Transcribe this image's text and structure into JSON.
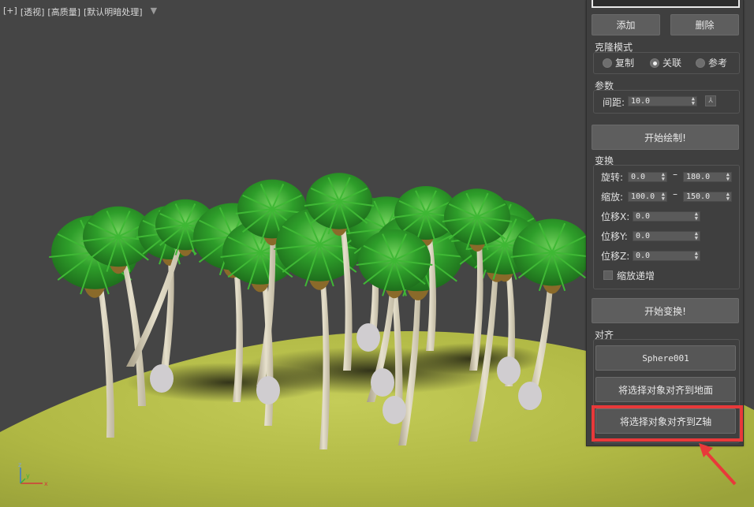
{
  "viewport": {
    "labels": [
      "[+]",
      "[透视]",
      "[高质量]",
      "[默认明暗处理]"
    ],
    "filter_icon": "funnel-icon",
    "gizmo": {
      "x_label": "x",
      "y_label": "y",
      "z_label": "z"
    }
  },
  "panel": {
    "add_label": "添加",
    "delete_label": "删除",
    "clone_mode": {
      "title": "克隆模式",
      "options": [
        {
          "label": "复制",
          "selected": false
        },
        {
          "label": "关联",
          "selected": true
        },
        {
          "label": "参考",
          "selected": false
        }
      ]
    },
    "params": {
      "title": "参数",
      "spacing_label": "间距:",
      "spacing_value": "10.0",
      "lock_label": "⅄"
    },
    "start_paint_label": "开始绘制!",
    "transform": {
      "title": "变换",
      "rotate_label": "旋转:",
      "rotate_min": "0.0",
      "rotate_max": "180.0",
      "scale_label": "缩放:",
      "scale_min": "100.0",
      "scale_max": "150.0",
      "dash": "–",
      "offset_x_label": "位移X:",
      "offset_x_value": "0.0",
      "offset_y_label": "位移Y:",
      "offset_y_value": "0.0",
      "offset_z_label": "位移Z:",
      "offset_z_value": "0.0",
      "scale_increment_label": "缩放递增"
    },
    "start_transform_label": "开始变换!",
    "align": {
      "title": "对齐",
      "target_label": "Sphere001",
      "align_ground_label": "将选择对象对齐到地面",
      "align_z_label": "将选择对象对齐到Z轴"
    }
  },
  "colors": {
    "highlight": "#e8393a",
    "ground": "#b8c24a",
    "foliage": "#2f9a2a",
    "trunk": "#d8d2bc",
    "viewport_bg": "#454545"
  }
}
